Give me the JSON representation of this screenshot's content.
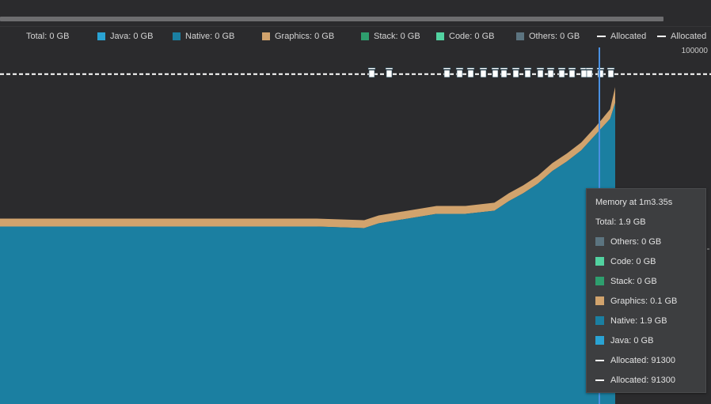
{
  "header": {
    "title_fragment": ""
  },
  "legend": [
    {
      "label": "Total: 0 GB",
      "color": null,
      "kind": "none"
    },
    {
      "label": "Java: 0 GB",
      "color": "#2aa3d3",
      "kind": "swatch"
    },
    {
      "label": "Native: 0 GB",
      "color": "#1b7fa1",
      "kind": "swatch"
    },
    {
      "label": "Graphics: 0 GB",
      "color": "#d1a36d",
      "kind": "swatch"
    },
    {
      "label": "Stack: 0 GB",
      "color": "#2e9e6e",
      "kind": "swatch"
    },
    {
      "label": "Code: 0 GB",
      "color": "#52d2a0",
      "kind": "swatch"
    },
    {
      "label": "Others: 0 GB",
      "color": "#5c7480",
      "kind": "swatch"
    },
    {
      "label": "Allocated",
      "color": "#ffffff",
      "kind": "dash"
    },
    {
      "label": "Allocated",
      "color": "#ffffff",
      "kind": "dash"
    }
  ],
  "axis": {
    "right_max_label": "100000"
  },
  "tooltip": {
    "title": "Memory at 1m3.35s",
    "total": "Total: 1.9 GB",
    "rows": [
      {
        "label": "Others: 0 GB",
        "color": "#5c7480",
        "kind": "swatch"
      },
      {
        "label": "Code: 0 GB",
        "color": "#52d2a0",
        "kind": "swatch"
      },
      {
        "label": "Stack: 0 GB",
        "color": "#2e9e6e",
        "kind": "swatch"
      },
      {
        "label": "Graphics: 0.1 GB",
        "color": "#d1a36d",
        "kind": "swatch"
      },
      {
        "label": "Native: 1.9 GB",
        "color": "#1b7fa1",
        "kind": "swatch"
      },
      {
        "label": "Java: 0 GB",
        "color": "#2aa3d3",
        "kind": "swatch"
      },
      {
        "label": "Allocated: 91300",
        "color": "#ffffff",
        "kind": "dash"
      },
      {
        "label": "Allocated: 91300",
        "color": "#ffffff",
        "kind": "dash"
      }
    ]
  },
  "colors": {
    "background": "#2b2b2d",
    "native": "#1b7fa1",
    "graphics": "#d1a36d",
    "cursor": "#4a90e2",
    "allocated_line": "#ffffff"
  },
  "chart_data": {
    "type": "area",
    "title": "",
    "xlabel": "",
    "ylabel": "",
    "x_unit": "seconds",
    "ylim_gb": [
      0,
      2.25
    ],
    "right_axis_max": 100000,
    "stacked": true,
    "x": [
      0,
      20,
      40,
      46,
      47,
      51,
      52,
      53,
      55,
      56,
      57,
      58,
      59,
      60,
      61,
      62,
      63,
      63.35
    ],
    "series": [
      {
        "name": "Native",
        "values": [
          1.12,
          1.12,
          1.12,
          1.11,
          1.14,
          1.2,
          1.2,
          1.2,
          1.22,
          1.28,
          1.33,
          1.39,
          1.47,
          1.53,
          1.6,
          1.7,
          1.8,
          1.9
        ]
      },
      {
        "name": "Graphics",
        "values": [
          0.05,
          0.05,
          0.05,
          0.05,
          0.05,
          0.05,
          0.05,
          0.05,
          0.05,
          0.05,
          0.05,
          0.05,
          0.05,
          0.05,
          0.05,
          0.05,
          0.06,
          0.1
        ]
      },
      {
        "name": "Java",
        "values": [
          0,
          0,
          0,
          0,
          0,
          0,
          0,
          0,
          0,
          0,
          0,
          0,
          0,
          0,
          0,
          0,
          0,
          0
        ]
      }
    ],
    "allocated": {
      "name": "Allocated",
      "value": 91300
    },
    "gc_events_seconds": [
      46.6,
      48.7,
      55.7,
      57.0,
      58.1,
      59.0,
      60.2,
      61.6,
      62.2,
      63.2,
      64.5,
      65.8,
      67.2,
      68.4,
      69.8,
      71.2,
      72.8,
      74.2,
      75.6,
      76.9,
      78.1
    ],
    "cursor_seconds": 63.35,
    "tooltip_time": "1m3.35s"
  }
}
